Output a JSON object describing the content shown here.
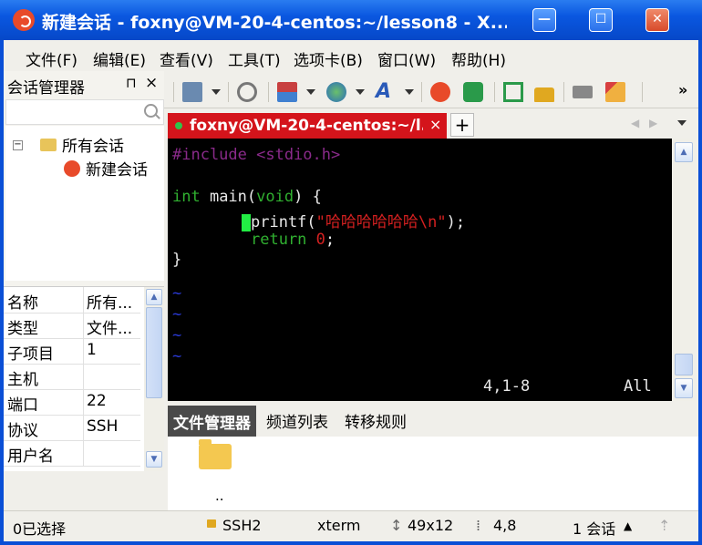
{
  "window": {
    "title": "新建会话 - foxny@VM-20-4-centos:~/lesson8 - X..."
  },
  "menubar": {
    "items": [
      "文件(F)",
      "编辑(E)",
      "查看(V)",
      "工具(T)",
      "选项卡(B)",
      "窗口(W)",
      "帮助(H)"
    ]
  },
  "session_manager": {
    "title": "会话管理器",
    "pin": "⊓",
    "close": "×",
    "tree": {
      "root": "所有会话",
      "child": "新建会话"
    },
    "properties": [
      {
        "key": "名称",
        "value": "所有..."
      },
      {
        "key": "类型",
        "value": "文件..."
      },
      {
        "key": "子项目",
        "value": "1"
      },
      {
        "key": "主机",
        "value": ""
      },
      {
        "key": "端口",
        "value": "22"
      },
      {
        "key": "协议",
        "value": "SSH"
      },
      {
        "key": "用户名",
        "value": ""
      }
    ]
  },
  "tab": {
    "label": "foxny@VM-20-4-centos:~/l...",
    "close": "×",
    "add": "+"
  },
  "terminal": {
    "include": "#include <stdio.h>",
    "main_kw": "int",
    "main_rest": " main(",
    "void_kw": "void",
    "main_end": ") {",
    "printf_pre": "printf(",
    "printf_str": "\"哈哈哈哈哈哈\\n\"",
    "printf_end": ");",
    "return_kw": "return",
    "return_val": "0",
    "return_end": ";",
    "close_brace": "}",
    "tilde": "~",
    "position": "4,1-8",
    "scroll": "All"
  },
  "bottom_tabs": [
    "文件管理器",
    "频道列表",
    "转移规则"
  ],
  "file_pane": {
    "parent": ".."
  },
  "statusbar": {
    "selected": "0已选择",
    "protocol": "SSH2",
    "term": "xterm",
    "size": "49x12",
    "cursor": "4,8",
    "sessions": "1 会话"
  }
}
